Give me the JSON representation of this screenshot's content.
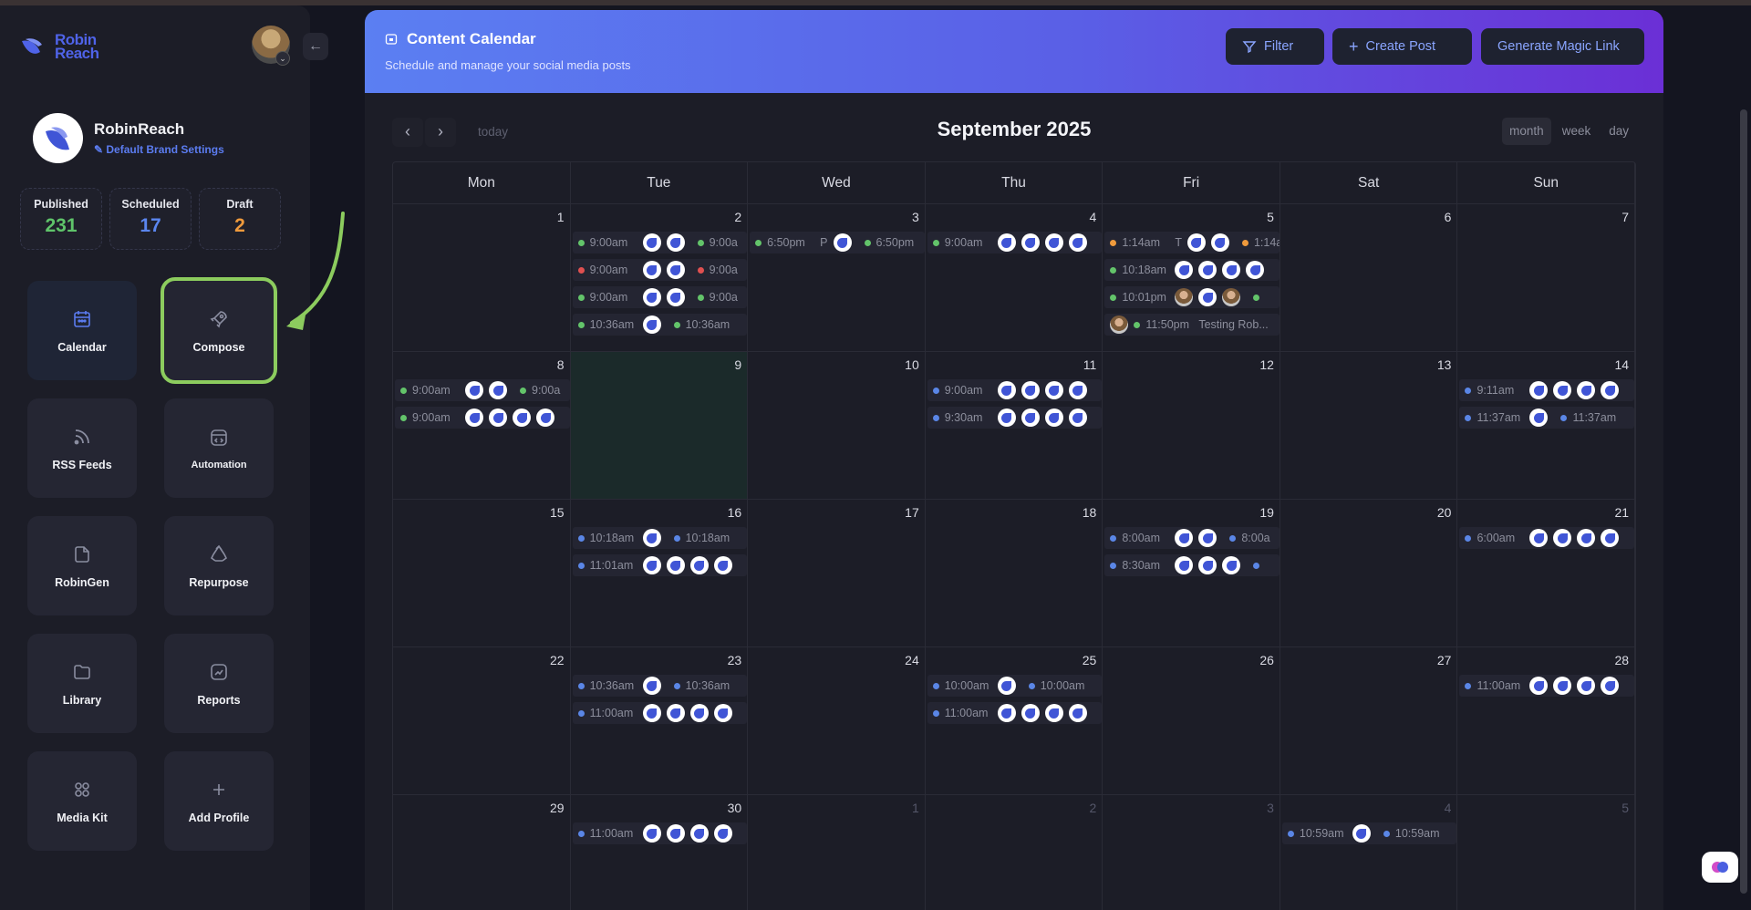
{
  "app": {
    "logo_text": "Robin Reach"
  },
  "brand": {
    "name": "RobinReach",
    "settings_link": "Default Brand Settings"
  },
  "stats": [
    {
      "label": "Published",
      "value": "231",
      "color": "#5fc46a"
    },
    {
      "label": "Scheduled",
      "value": "17",
      "color": "#5b86f0"
    },
    {
      "label": "Draft",
      "value": "2",
      "color": "#ef9a3c"
    }
  ],
  "tiles": [
    {
      "label": "Calendar",
      "icon": "calendar-icon"
    },
    {
      "label": "Compose",
      "icon": "rocket-icon"
    },
    {
      "label": "RSS Feeds",
      "icon": "rss-icon"
    },
    {
      "label": "Automation",
      "icon": "automation-icon"
    },
    {
      "label": "RobinGen",
      "icon": "document-icon"
    },
    {
      "label": "Repurpose",
      "icon": "recycle-icon"
    },
    {
      "label": "Library",
      "icon": "folder-icon"
    },
    {
      "label": "Reports",
      "icon": "chart-icon"
    },
    {
      "label": "Media Kit",
      "icon": "grid-icon"
    },
    {
      "label": "Add Profile",
      "icon": "plus-icon"
    }
  ],
  "header": {
    "title": "Content Calendar",
    "subtitle": "Schedule and manage your social media posts",
    "filter_label": "Filter",
    "create_label": "Create Post",
    "magic_label": "Generate Magic Link"
  },
  "calendar": {
    "month_title": "September 2025",
    "today_label": "today",
    "views": [
      "month",
      "week",
      "day"
    ],
    "weekdays": [
      "Mon",
      "Tue",
      "Wed",
      "Thu",
      "Fri",
      "Sat",
      "Sun"
    ],
    "weeks": [
      [
        {
          "num": "1",
          "events": []
        },
        {
          "num": "2",
          "events": [
            {
              "c": "g",
              "t": "9:00am",
              "a": [
                "l",
                "l"
              ],
              "t2": "9:00a",
              "c2": "g"
            },
            {
              "c": "r",
              "t": "9:00am",
              "a": [
                "l",
                "l"
              ],
              "t2": "9:00a",
              "c2": "r"
            },
            {
              "c": "g",
              "t": "9:00am",
              "a": [
                "l",
                "l"
              ],
              "t2": "9:00a",
              "c2": "g"
            },
            {
              "c": "g",
              "t": "10:36am",
              "a": [
                "l"
              ],
              "t2": "10:36am",
              "c2": "g"
            }
          ]
        },
        {
          "num": "3",
          "events": [
            {
              "c": "g",
              "t": "6:50pm",
              "x": "P",
              "a": [
                "l"
              ],
              "t2": "6:50pm",
              "c2": "g",
              "x2": "P"
            }
          ]
        },
        {
          "num": "4",
          "events": [
            {
              "c": "g",
              "t": "9:00am",
              "a": [
                "l",
                "l",
                "l",
                "l"
              ]
            }
          ]
        },
        {
          "num": "5",
          "events": [
            {
              "c": "o",
              "t": "1:14am",
              "x": "T",
              "a": [
                "l",
                "l"
              ],
              "t2": "1:14am",
              "c2": "o",
              "x2": "T..."
            },
            {
              "c": "g",
              "t": "10:18am",
              "a": [
                "l",
                "l",
                "l",
                "l"
              ]
            },
            {
              "c": "g",
              "t": "10:01pm",
              "a": [
                "p",
                "l",
                "p"
              ],
              "c2": "g"
            },
            {
              "c": "g",
              "t": "11:50pm",
              "x": "Testing Rob...",
              "pre": "p"
            }
          ]
        },
        {
          "num": "6",
          "events": []
        },
        {
          "num": "7",
          "events": []
        }
      ],
      [
        {
          "num": "8",
          "events": [
            {
              "c": "g",
              "t": "9:00am",
              "a": [
                "l",
                "l"
              ],
              "t2": "9:00a",
              "c2": "g"
            },
            {
              "c": "g",
              "t": "9:00am",
              "a": [
                "l",
                "l",
                "l",
                "l"
              ]
            }
          ]
        },
        {
          "num": "9",
          "today": true,
          "events": []
        },
        {
          "num": "10",
          "events": []
        },
        {
          "num": "11",
          "events": [
            {
              "c": "b",
              "t": "9:00am",
              "a": [
                "l",
                "l",
                "l",
                "l"
              ]
            },
            {
              "c": "b",
              "t": "9:30am",
              "a": [
                "l",
                "l",
                "l",
                "l"
              ]
            }
          ]
        },
        {
          "num": "12",
          "events": []
        },
        {
          "num": "13",
          "events": []
        },
        {
          "num": "14",
          "events": [
            {
              "c": "b",
              "t": "9:11am",
              "a": [
                "l",
                "l",
                "l",
                "l"
              ]
            },
            {
              "c": "b",
              "t": "11:37am",
              "a": [
                "l"
              ],
              "t2": "11:37am",
              "c2": "b"
            }
          ]
        }
      ],
      [
        {
          "num": "15",
          "events": []
        },
        {
          "num": "16",
          "events": [
            {
              "c": "b",
              "t": "10:18am",
              "a": [
                "l"
              ],
              "t2": "10:18am",
              "c2": "b"
            },
            {
              "c": "b",
              "t": "11:01am",
              "a": [
                "l",
                "l",
                "l",
                "l"
              ]
            }
          ]
        },
        {
          "num": "17",
          "events": []
        },
        {
          "num": "18",
          "events": []
        },
        {
          "num": "19",
          "events": [
            {
              "c": "b",
              "t": "8:00am",
              "a": [
                "l",
                "l"
              ],
              "t2": "8:00a",
              "c2": "b"
            },
            {
              "c": "b",
              "t": "8:30am",
              "a": [
                "l",
                "l",
                "l"
              ],
              "c2": "b"
            }
          ]
        },
        {
          "num": "20",
          "events": []
        },
        {
          "num": "21",
          "events": [
            {
              "c": "b",
              "t": "6:00am",
              "a": [
                "l",
                "l",
                "l",
                "l"
              ]
            }
          ]
        }
      ],
      [
        {
          "num": "22",
          "events": []
        },
        {
          "num": "23",
          "events": [
            {
              "c": "b",
              "t": "10:36am",
              "a": [
                "l"
              ],
              "t2": "10:36am",
              "c2": "b"
            },
            {
              "c": "b",
              "t": "11:00am",
              "a": [
                "l",
                "l",
                "l",
                "l"
              ]
            }
          ]
        },
        {
          "num": "24",
          "events": []
        },
        {
          "num": "25",
          "events": [
            {
              "c": "b",
              "t": "10:00am",
              "a": [
                "l"
              ],
              "t2": "10:00am",
              "c2": "b"
            },
            {
              "c": "b",
              "t": "11:00am",
              "a": [
                "l",
                "l",
                "l",
                "l"
              ]
            }
          ]
        },
        {
          "num": "26",
          "events": []
        },
        {
          "num": "27",
          "events": []
        },
        {
          "num": "28",
          "events": [
            {
              "c": "b",
              "t": "11:00am",
              "a": [
                "l",
                "l",
                "l",
                "l"
              ]
            }
          ]
        }
      ],
      [
        {
          "num": "29",
          "events": []
        },
        {
          "num": "30",
          "events": [
            {
              "c": "b",
              "t": "11:00am",
              "a": [
                "l",
                "l",
                "l",
                "l"
              ]
            }
          ]
        },
        {
          "num": "1",
          "other": true,
          "events": []
        },
        {
          "num": "2",
          "other": true,
          "events": []
        },
        {
          "num": "3",
          "other": true,
          "events": []
        },
        {
          "num": "4",
          "other": true,
          "events": [
            {
              "c": "b",
              "t": "10:59am",
              "a": [
                "l"
              ],
              "t2": "10:59am",
              "c2": "b"
            }
          ]
        },
        {
          "num": "5",
          "other": true,
          "events": []
        }
      ]
    ]
  },
  "colors": {
    "accent": "#5b7cf0",
    "highlight": "#8ccc5e",
    "header_start": "#5b7ff2",
    "header_end": "#6b2fd6"
  }
}
